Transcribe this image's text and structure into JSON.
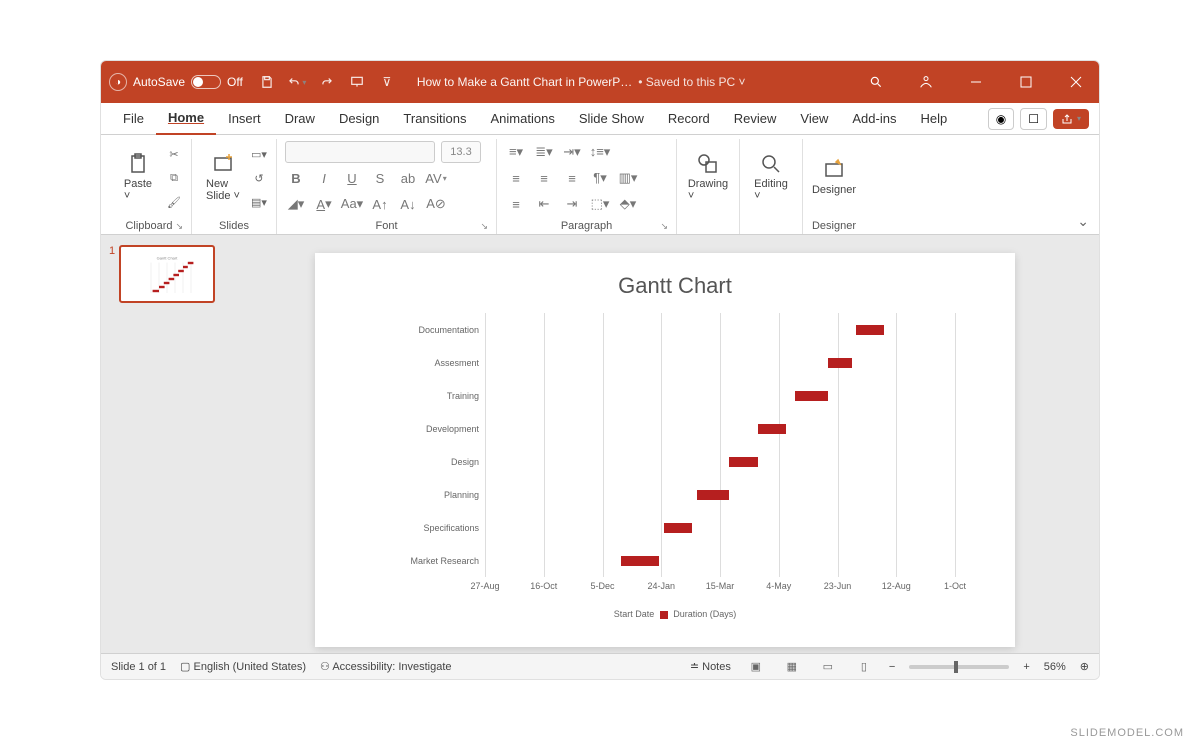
{
  "titlebar": {
    "autosave_label": "AutoSave",
    "autosave_state": "Off",
    "doc_title": "How to Make a Gantt Chart in PowerP…",
    "saved_status": "• Saved to this PC ˅"
  },
  "tabs": [
    "File",
    "Home",
    "Insert",
    "Draw",
    "Design",
    "Transitions",
    "Animations",
    "Slide Show",
    "Record",
    "Review",
    "View",
    "Add-ins",
    "Help"
  ],
  "active_tab": "Home",
  "ribbon": {
    "clipboard": {
      "label": "Clipboard",
      "paste": "Paste"
    },
    "slides": {
      "label": "Slides",
      "new_slide": "New\nSlide"
    },
    "font": {
      "label": "Font",
      "size": "13.3"
    },
    "paragraph": {
      "label": "Paragraph"
    },
    "drawing": {
      "label": "Drawing"
    },
    "editing": {
      "label": "Editing"
    },
    "designer": {
      "label": "Designer",
      "btn": "Designer"
    }
  },
  "thumb_num": "1",
  "statusbar": {
    "slide_pos": "Slide 1 of 1",
    "lang": "English (United States)",
    "access": "Accessibility: Investigate",
    "notes": "Notes",
    "zoom": "56%"
  },
  "watermark": "SLIDEMODEL.COM",
  "chart_data": {
    "type": "bar",
    "title": "Gantt Chart",
    "xlabel": "",
    "ylabel": "",
    "categories": [
      "Market Research",
      "Specifications",
      "Planning",
      "Design",
      "Development",
      "Training",
      "Assesment",
      "Documentation"
    ],
    "x_ticks": [
      "27-Aug",
      "16-Oct",
      "5-Dec",
      "24-Jan",
      "15-Mar",
      "4-May",
      "23-Jun",
      "12-Aug",
      "1-Oct"
    ],
    "series": [
      {
        "name": "Start Date",
        "values": [
          145,
          190,
          225,
          260,
          290,
          330,
          365,
          395
        ]
      },
      {
        "name": "Duration (Days)",
        "values": [
          40,
          30,
          35,
          30,
          30,
          35,
          25,
          30
        ]
      }
    ],
    "x_domain": [
      0,
      500
    ],
    "legend": [
      "Start Date",
      "Duration (Days)"
    ],
    "bar_color": "#b61f1f"
  }
}
